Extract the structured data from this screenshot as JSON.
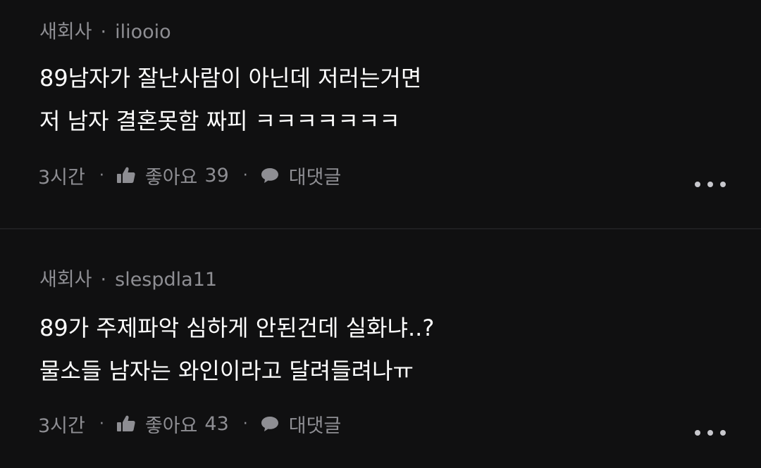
{
  "comments": [
    {
      "author_group": "새회사",
      "separator": "·",
      "username": "iliooio",
      "lines": [
        "89남자가 잘난사람이 아닌데 저러는거면",
        "저 남자 결혼못함 짜피 ㅋㅋㅋㅋㅋㅋㅋ"
      ],
      "time": "3시간",
      "action_separator": "·",
      "like_label": "좋아요",
      "like_count": "39",
      "reply_label": "대댓글"
    },
    {
      "author_group": "새회사",
      "separator": "·",
      "username": "slespdla11",
      "lines": [
        "89가 주제파악 심하게 안된건데 실화냐..?",
        "물소들 남자는 와인이라고 달려들려나ㅠ"
      ],
      "time": "3시간",
      "action_separator": "·",
      "like_label": "좋아요",
      "like_count": "43",
      "reply_label": "대댓글"
    }
  ],
  "icons": {
    "like": "thumbs-up-icon",
    "reply": "speech-bubble-icon",
    "more": "more-horizontal-icon"
  },
  "colors": {
    "background": "#101011",
    "primary_text": "#ffffff",
    "secondary_text": "#8e8e93",
    "divider": "#1f1f21"
  }
}
